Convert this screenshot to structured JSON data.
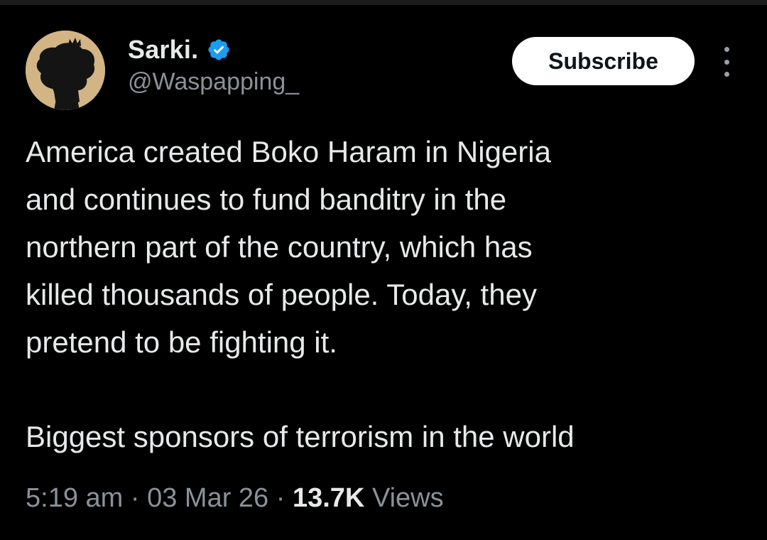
{
  "author": {
    "display_name": "Sarki.",
    "handle": "@Waspapping_",
    "verified": true,
    "verified_color": "#1d9bf0",
    "avatar_icon": "silhouette-with-crown-avatar"
  },
  "actions": {
    "subscribe_label": "Subscribe",
    "more_icon": "more-vertical-icon"
  },
  "tweet": {
    "paragraphs": [
      "America created Boko Haram in Nigeria\nand continues to fund banditry in the\nnorthern part of the country, which has\nkilled thousands of people. Today, they\npretend to be fighting it.",
      "Biggest sponsors of terrorism in the world"
    ]
  },
  "meta": {
    "time": "5:19 am",
    "separator": " · ",
    "date": "03 Mar 26",
    "views_count": "13.7K",
    "views_label": "Views"
  },
  "colors": {
    "background": "#000000",
    "primary_text": "#e7e9ea",
    "secondary_text": "#8b9198",
    "button_bg": "#ffffff",
    "button_text": "#0f1419",
    "avatar_bg": "#d2b485"
  }
}
